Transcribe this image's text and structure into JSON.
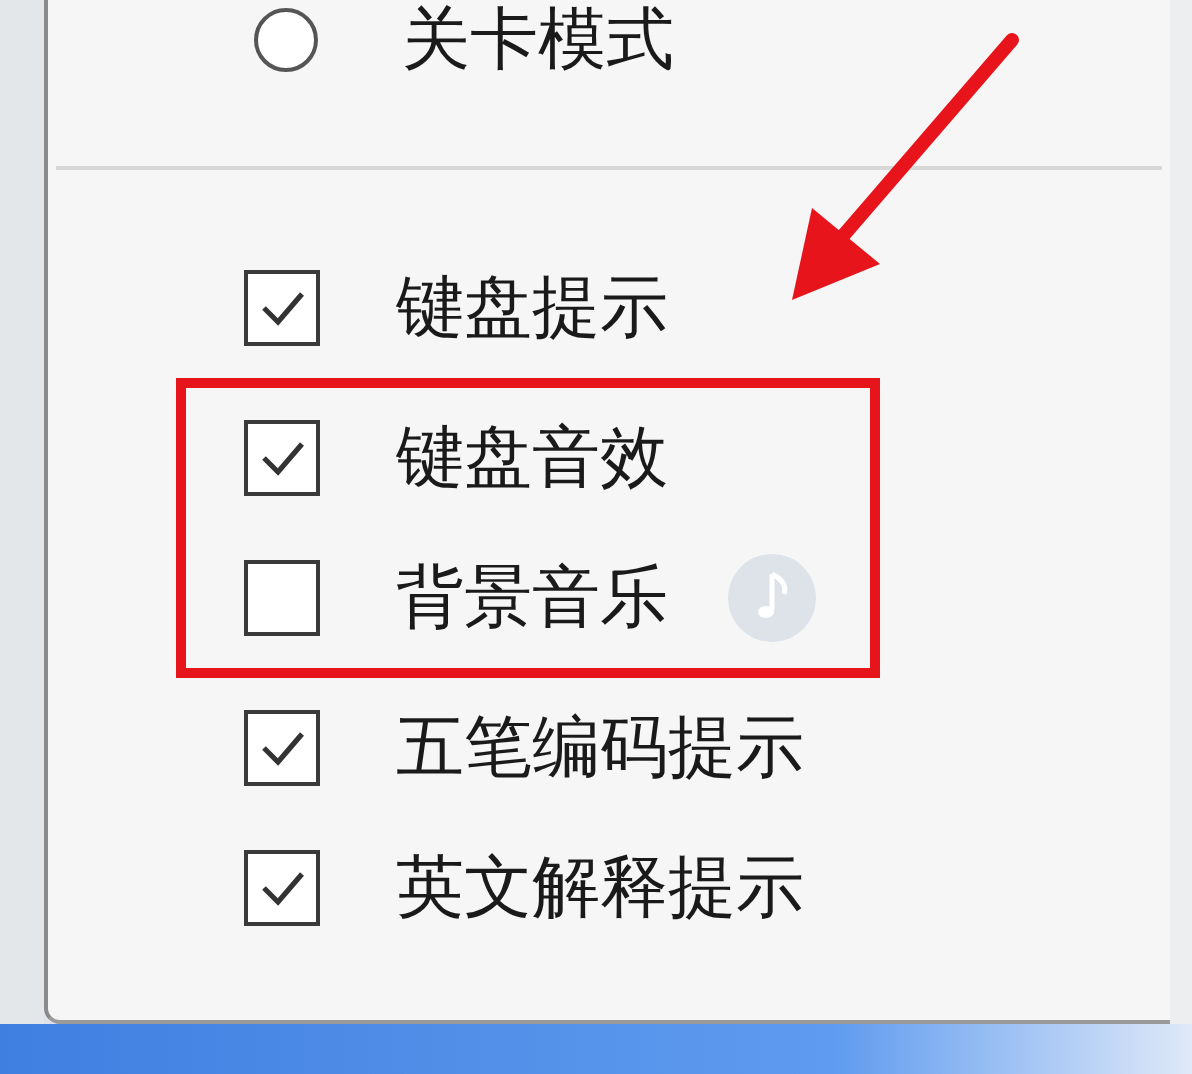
{
  "menu": {
    "items": [
      {
        "kind": "radio",
        "label": "关卡模式",
        "selected": false,
        "highlighted": false
      },
      {
        "kind": "divider"
      },
      {
        "kind": "checkbox",
        "label": "键盘提示",
        "checked": true,
        "highlighted": false
      },
      {
        "kind": "checkbox",
        "label": "键盘音效",
        "checked": true,
        "highlighted": true
      },
      {
        "kind": "checkbox",
        "label": "背景音乐",
        "checked": false,
        "highlighted": true,
        "note_icon": true
      },
      {
        "kind": "checkbox",
        "label": "五笔编码提示",
        "checked": true,
        "highlighted": false
      },
      {
        "kind": "checkbox",
        "label": "英文解释提示",
        "checked": true,
        "highlighted": false
      }
    ]
  }
}
